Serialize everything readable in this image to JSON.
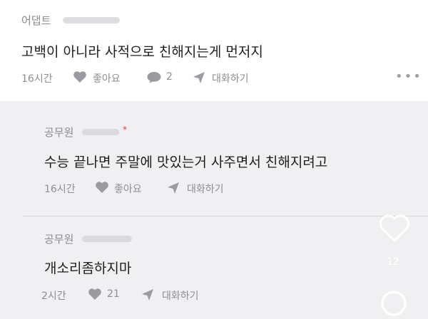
{
  "comment": {
    "author": "어댑트",
    "text": "고백이 아니라 사적으로 친해지는게 먼저지",
    "time": "16시간",
    "like_label": "좋아요",
    "reply_count": "2",
    "reply_label": "대화하기"
  },
  "replies": [
    {
      "author": "공무원",
      "text": "수능 끝나면 주말에 맛있는거 사주면서 친해지려고",
      "time": "16시간",
      "like_label": "좋아요",
      "reply_label": "대화하기"
    },
    {
      "author": "공무원",
      "text": "개소리좀하지마",
      "time": "2시간",
      "like_count": "21",
      "reply_label": "대화하기"
    }
  ],
  "side": {
    "like_count": "12"
  },
  "colors": {
    "reply_bg": "#f0f0f2",
    "meta_gray": "#8e8e93",
    "star_red": "#e53935"
  },
  "icons": [
    "heart-icon",
    "speech-bubble-icon",
    "send-icon",
    "more-icon",
    "search-icon"
  ]
}
